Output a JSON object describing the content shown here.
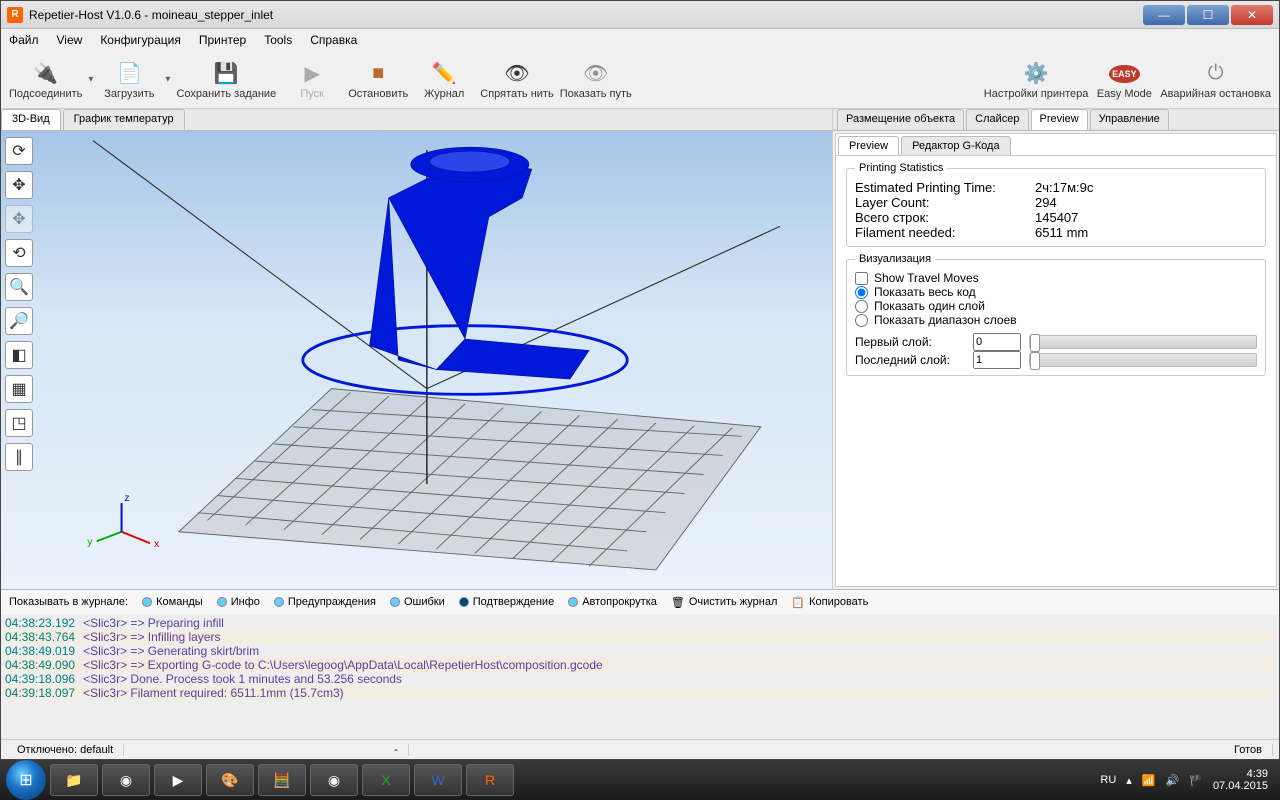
{
  "title": "Repetier-Host V1.0.6 - moineau_stepper_inlet",
  "menu": [
    "Файл",
    "View",
    "Конфигурация",
    "Принтер",
    "Tools",
    "Справка"
  ],
  "toolbar": {
    "connect": "Подсоединить",
    "load": "Загрузить",
    "save": "Сохранить задание",
    "run": "Пуск",
    "stop": "Остановить",
    "log": "Журнал",
    "hide": "Спрятать нить",
    "show_path": "Показать путь",
    "printer_settings": "Настройки принтера",
    "easy": "Easy Mode",
    "emergency": "Аварийная остановка"
  },
  "left_tabs": {
    "t3d": "3D-Вид",
    "temp": "График температур"
  },
  "right_tabs": {
    "placement": "Размещение объекта",
    "slicer": "Слайсер",
    "preview": "Preview",
    "control": "Управление"
  },
  "sub_tabs": {
    "preview": "Preview",
    "editor": "Редактор G-Кода"
  },
  "stats": {
    "group": "Printing Statistics",
    "est_label": "Estimated Printing Time:",
    "est_value": "2ч:17м:9с",
    "layers_label": "Layer Count:",
    "layers_value": "294",
    "lines_label": "Всего строк:",
    "lines_value": "145407",
    "filament_label": "Filament needed:",
    "filament_value": "6511 mm"
  },
  "viz": {
    "group": "Визуализация",
    "travel": "Show Travel Moves",
    "all": "Показать весь код",
    "single": "Показать один слой",
    "range": "Показать диапазон слоев",
    "first": "Первый слой:",
    "first_val": "0",
    "last": "Последний слой:",
    "last_val": "1"
  },
  "log_toolbar": {
    "show": "Показывать в журнале:",
    "commands": "Команды",
    "info": "Инфо",
    "warn": "Предупраждения",
    "errors": "Ошибки",
    "ack": "Подтверждение",
    "auto": "Автопрокрутка",
    "clear": "Очистить журнал",
    "copy": "Копировать"
  },
  "log": [
    {
      "ts": "04:38:23.192",
      "msg": "<Slic3r> => Preparing infill"
    },
    {
      "ts": "04:38:43.764",
      "msg": "<Slic3r> => Infilling layers"
    },
    {
      "ts": "04:38:49.019",
      "msg": "<Slic3r> => Generating skirt/brim"
    },
    {
      "ts": "04:38:49.090",
      "msg": "<Slic3r> => Exporting G-code to C:\\Users\\legoog\\AppData\\Local\\RepetierHost\\composition.gcode"
    },
    {
      "ts": "04:39:18.096",
      "msg": "<Slic3r> Done. Process took 1 minutes and 53.256 seconds"
    },
    {
      "ts": "04:39:18.097",
      "msg": "<Slic3r> Filament required: 6511.1mm (15.7cm3)"
    }
  ],
  "status": {
    "left": "Отключено: default",
    "mid": "-",
    "right": "Готов"
  },
  "tray": {
    "lang": "RU",
    "time": "4:39",
    "date": "07.04.2015"
  }
}
